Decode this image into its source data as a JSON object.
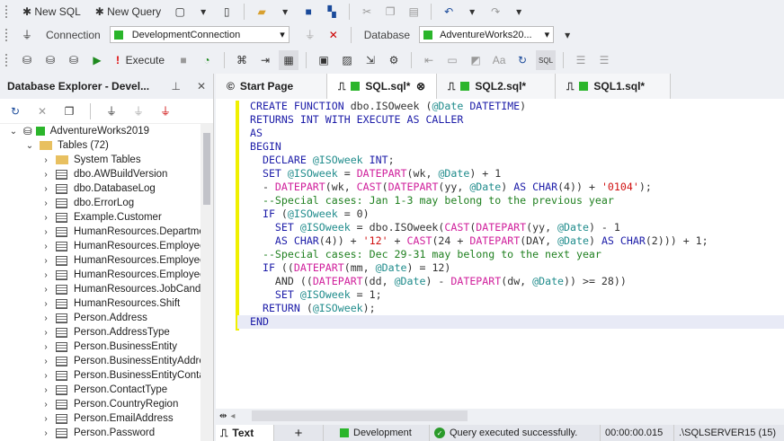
{
  "toolbar1": {
    "new_sql": "New SQL",
    "new_query": "New Query"
  },
  "toolbar2": {
    "connection_label": "Connection",
    "connection_value": "DevelopmentConnection",
    "database_label": "Database",
    "database_value": "AdventureWorks20..."
  },
  "toolbar3": {
    "execute": "Execute"
  },
  "explorer": {
    "title": "Database Explorer - Devel...",
    "db": "AdventureWorks2019",
    "tables": "Tables (72)",
    "items": [
      "System Tables",
      "dbo.AWBuildVersion",
      "dbo.DatabaseLog",
      "dbo.ErrorLog",
      "Example.Customer",
      "HumanResources.Department",
      "HumanResources.Employee",
      "HumanResources.EmployeeDepartmentHistory",
      "HumanResources.EmployeePayHistory",
      "HumanResources.JobCandidate",
      "HumanResources.Shift",
      "Person.Address",
      "Person.AddressType",
      "Person.BusinessEntity",
      "Person.BusinessEntityAddress",
      "Person.BusinessEntityContact",
      "Person.ContactType",
      "Person.CountryRegion",
      "Person.EmailAddress",
      "Person.Password"
    ]
  },
  "tabs": [
    {
      "label": "Start Page"
    },
    {
      "label": "SQL.sql*"
    },
    {
      "label": "SQL2.sql*"
    },
    {
      "label": "SQL1.sql*"
    }
  ],
  "code": [
    [
      [
        "k",
        "CREATE FUNCTION "
      ],
      [
        "p",
        "dbo.ISOweek ("
      ],
      [
        "v",
        "@Date"
      ],
      [
        "k",
        " DATETIME"
      ],
      [
        "p",
        ")"
      ]
    ],
    [
      [
        "k",
        "RETURNS INT WITH EXECUTE AS CALLER"
      ]
    ],
    [
      [
        "k",
        "AS"
      ]
    ],
    [
      [
        "k",
        "BEGIN"
      ]
    ],
    [
      [
        "k",
        "  DECLARE "
      ],
      [
        "v",
        "@ISOweek"
      ],
      [
        "k",
        " INT"
      ],
      [
        "p",
        ";"
      ]
    ],
    [
      [
        "k",
        "  SET "
      ],
      [
        "v",
        "@ISOweek"
      ],
      [
        "p",
        " = "
      ],
      [
        "f",
        "DATEPART"
      ],
      [
        "p",
        "(wk, "
      ],
      [
        "v",
        "@Date"
      ],
      [
        "p",
        ") + 1"
      ]
    ],
    [
      [
        "p",
        "  - "
      ],
      [
        "f",
        "DATEPART"
      ],
      [
        "p",
        "(wk, "
      ],
      [
        "f",
        "CAST"
      ],
      [
        "p",
        "("
      ],
      [
        "f",
        "DATEPART"
      ],
      [
        "p",
        "(yy, "
      ],
      [
        "v",
        "@Date"
      ],
      [
        "p",
        ") "
      ],
      [
        "k",
        "AS CHAR"
      ],
      [
        "p",
        "(4)) + "
      ],
      [
        "s",
        "'0104'"
      ],
      [
        "p",
        ");"
      ]
    ],
    [
      [
        "c",
        "  --Special cases: Jan 1-3 may belong to the previous year"
      ]
    ],
    [
      [
        "k",
        "  IF "
      ],
      [
        "p",
        "("
      ],
      [
        "v",
        "@ISOweek"
      ],
      [
        "p",
        " = 0)"
      ]
    ],
    [
      [
        "k",
        "    SET "
      ],
      [
        "v",
        "@ISOweek"
      ],
      [
        "p",
        " = dbo.ISOweek("
      ],
      [
        "f",
        "CAST"
      ],
      [
        "p",
        "("
      ],
      [
        "f",
        "DATEPART"
      ],
      [
        "p",
        "(yy, "
      ],
      [
        "v",
        "@Date"
      ],
      [
        "p",
        ") - 1"
      ]
    ],
    [
      [
        "k",
        "    AS CHAR"
      ],
      [
        "p",
        "(4)) + "
      ],
      [
        "s",
        "'12'"
      ],
      [
        "p",
        " + "
      ],
      [
        "f",
        "CAST"
      ],
      [
        "p",
        "(24 + "
      ],
      [
        "f",
        "DATEPART"
      ],
      [
        "p",
        "(DAY, "
      ],
      [
        "v",
        "@Date"
      ],
      [
        "p",
        ") "
      ],
      [
        "k",
        "AS CHAR"
      ],
      [
        "p",
        "(2))) + 1;"
      ]
    ],
    [
      [
        "c",
        "  --Special cases: Dec 29-31 may belong to the next year"
      ]
    ],
    [
      [
        "k",
        "  IF "
      ],
      [
        "p",
        "(("
      ],
      [
        "f",
        "DATEPART"
      ],
      [
        "p",
        "(mm, "
      ],
      [
        "v",
        "@Date"
      ],
      [
        "p",
        ") = 12)"
      ]
    ],
    [
      [
        "p",
        "    AND (("
      ],
      [
        "f",
        "DATEPART"
      ],
      [
        "p",
        "(dd, "
      ],
      [
        "v",
        "@Date"
      ],
      [
        "p",
        ") - "
      ],
      [
        "f",
        "DATEPART"
      ],
      [
        "p",
        "(dw, "
      ],
      [
        "v",
        "@Date"
      ],
      [
        "p",
        ")) >= 28))"
      ]
    ],
    [
      [
        "k",
        "    SET "
      ],
      [
        "v",
        "@ISOweek"
      ],
      [
        "p",
        " = 1;"
      ]
    ],
    [
      [
        "k",
        "  RETURN "
      ],
      [
        "p",
        "("
      ],
      [
        "v",
        "@ISOweek"
      ],
      [
        "p",
        ");"
      ]
    ],
    [
      [
        "k",
        "END"
      ]
    ]
  ],
  "bottom": {
    "text_tab": "Text",
    "add": "+"
  },
  "status": {
    "connection": "Development",
    "message": "Query executed successfully.",
    "time": "00:00:00.015",
    "server": ".\\SQLSERVER15 (15)"
  },
  "colors": {
    "accent_green": "#2bb52b",
    "keyword": "#1c1ca8",
    "function": "#d0209c",
    "variable": "#208c8c",
    "string": "#d01010",
    "comment": "#208020"
  }
}
